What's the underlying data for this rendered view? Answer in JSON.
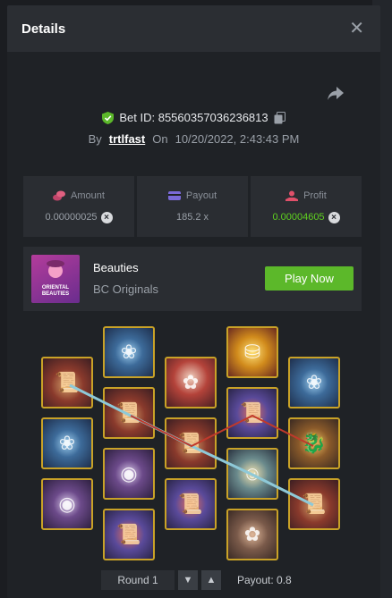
{
  "header": {
    "title": "Details"
  },
  "bet": {
    "id_label": "Bet ID: 85560357036236813",
    "by_label": "By",
    "user": "trtlfast",
    "on_label": "On",
    "datetime": "10/20/2022, 2:43:43 PM"
  },
  "stats": {
    "amount_label": "Amount",
    "amount_value": "0.00000025",
    "payout_label": "Payout",
    "payout_value": "185.2 x",
    "profit_label": "Profit",
    "profit_value": "0.00004605",
    "coin_symbol": "×"
  },
  "game": {
    "thumb_text": "ORIENTAL BEAUTIES",
    "name": "Beauties",
    "provider": "BC Originals",
    "play_label": "Play Now"
  },
  "round": {
    "label": "Round 1",
    "payout_label": "Payout: 0.8"
  },
  "colors": {
    "accent_green": "#5cb82a",
    "profit_green": "#5fd11f",
    "tile_border": "#c9a227",
    "payline_blue": "#8ec9d8",
    "payline_red": "#c0392b"
  },
  "tiles": [
    {
      "name": "book",
      "icon": "book-icon"
    },
    {
      "name": "lotus",
      "icon": "lotus-icon"
    },
    {
      "name": "ring",
      "icon": "ring-icon"
    },
    {
      "name": "lady",
      "icon": "lady-icon"
    },
    {
      "name": "gold",
      "icon": "gold-ingot-icon"
    },
    {
      "name": "mask",
      "icon": "mask-icon"
    },
    {
      "name": "dragon",
      "icon": "dragon-icon"
    }
  ]
}
